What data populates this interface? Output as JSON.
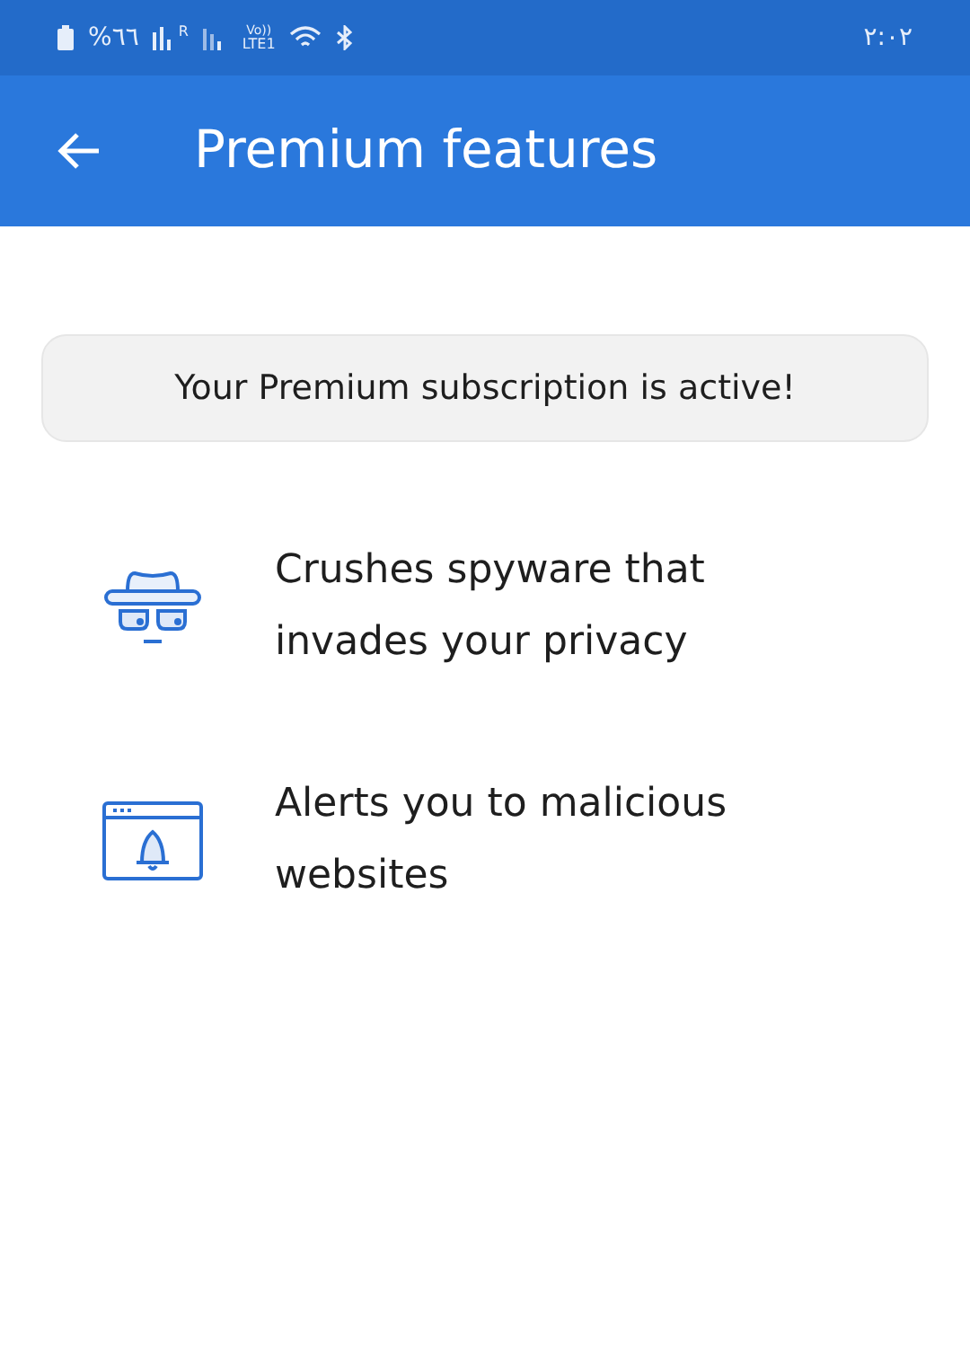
{
  "status_bar": {
    "battery": "%٦٦",
    "roaming": "R",
    "volte": "Vo))",
    "network": "LTE1",
    "time": "٢:٠٢"
  },
  "app_bar": {
    "title": "Premium features"
  },
  "banner": {
    "text": "Your Premium subscription is active!"
  },
  "features": [
    {
      "kind": "spy",
      "text": "Crushes spyware that invades your privacy"
    },
    {
      "kind": "alert",
      "text": "Alerts you to malicious websites"
    }
  ]
}
